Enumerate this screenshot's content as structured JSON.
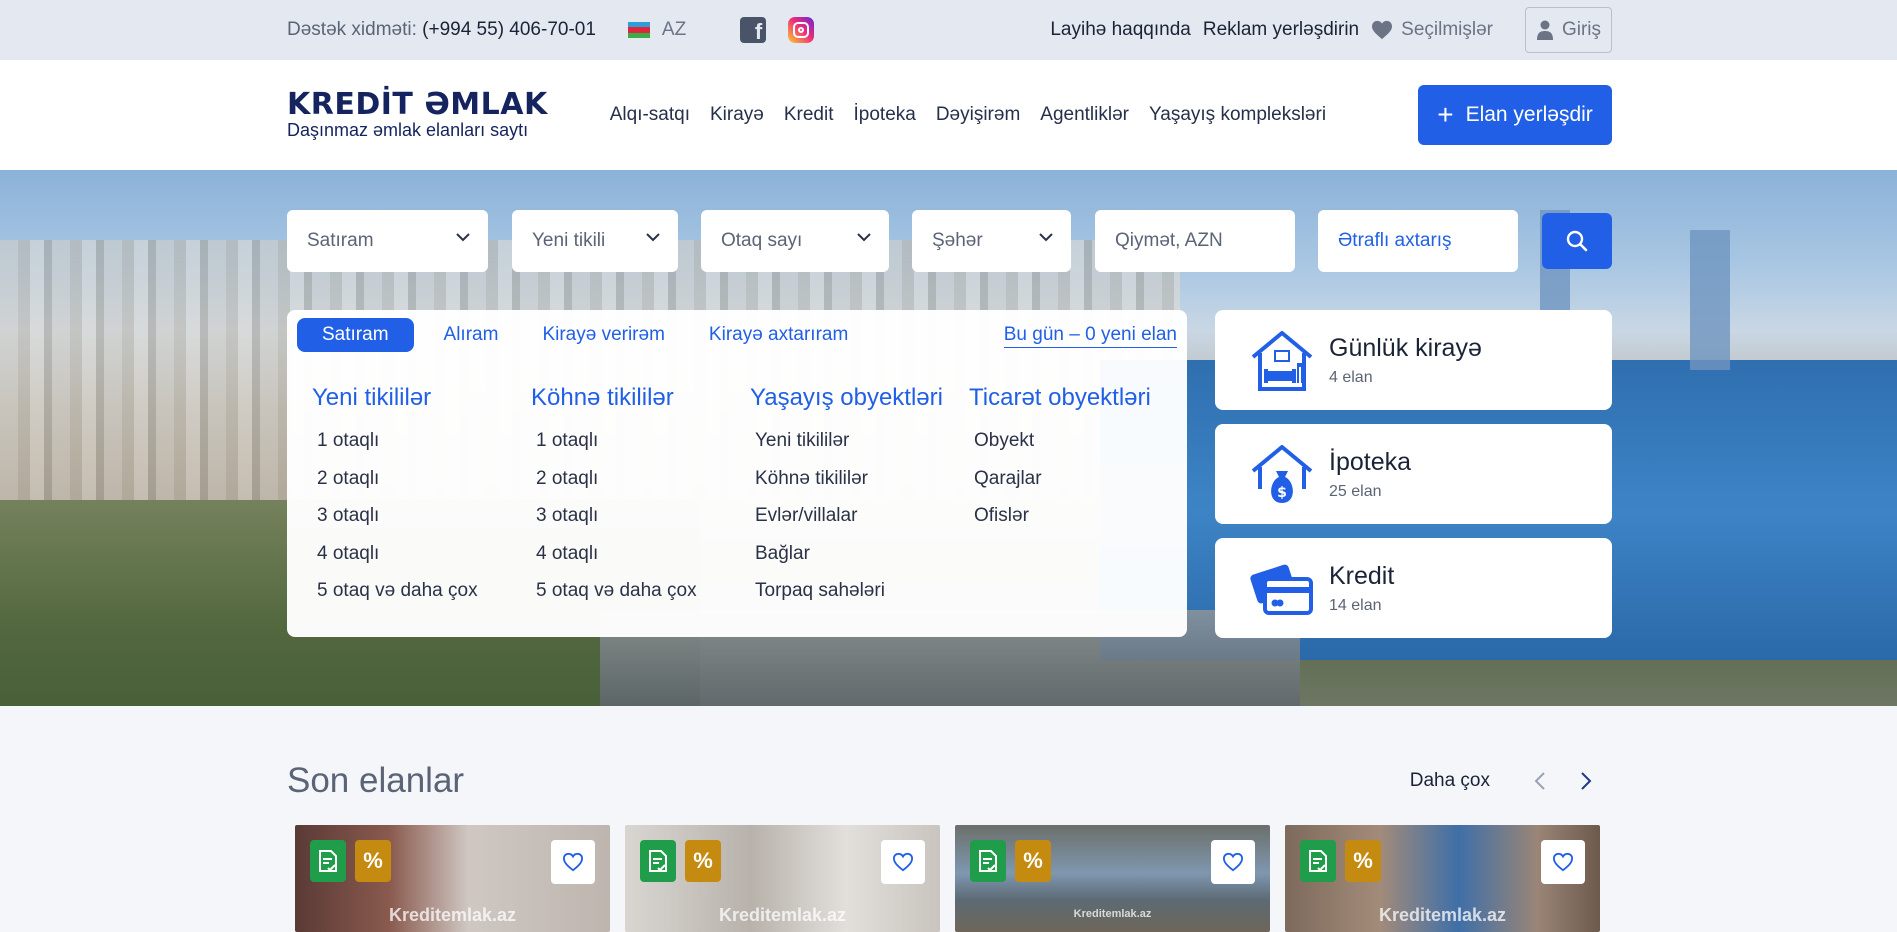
{
  "topbar": {
    "support_label": "Dəstək xidməti:",
    "support_phone": "(+994 55) 406-70-01",
    "language": "AZ",
    "links": [
      "Layihə haqqında",
      "Reklam yerləşdirin"
    ],
    "favorites": "Seçilmişlər",
    "login": "Giriş"
  },
  "header": {
    "logo_title": "KREDİT ƏMLAK",
    "logo_subtitle": "Daşınmaz əmlak elanları saytı",
    "nav": [
      "Alqı-satqı",
      "Kirayə",
      "Kredit",
      "İpoteka",
      "Dəyişirəm",
      "Agentliklər",
      "Yaşayış kompleksləri"
    ],
    "post_button": "Elan yerləşdir"
  },
  "search": {
    "deal_type": "Satıram",
    "building_type": "Yeni tikili",
    "rooms": "Otaq sayı",
    "city": "Şəhər",
    "price_placeholder": "Qiymət, AZN",
    "advanced": "Ətraflı axtarış"
  },
  "panel": {
    "tabs": [
      "Satıram",
      "Alıram",
      "Kirayə verirəm",
      "Kirayə axtarıram"
    ],
    "active_tab": "Satıram",
    "today": "Bu gün – 0 yeni elan",
    "columns": [
      {
        "title": "Yeni tikililər",
        "items": [
          "1 otaqlı",
          "2 otaqlı",
          "3 otaqlı",
          "4 otaqlı",
          "5 otaq və daha çox"
        ]
      },
      {
        "title": "Köhnə tikililər",
        "items": [
          "1 otaqlı",
          "2 otaqlı",
          "3 otaqlı",
          "4 otaqlı",
          "5 otaq və daha çox"
        ]
      },
      {
        "title": "Yaşayış obyektləri",
        "items": [
          "Yeni tikililər",
          "Köhnə tikililər",
          "Evlər/villalar",
          "Bağlar",
          "Torpaq sahələri"
        ]
      },
      {
        "title": "Ticarət obyektləri",
        "items": [
          "Obyekt",
          "Qarajlar",
          "Ofislər"
        ]
      }
    ]
  },
  "side_cards": [
    {
      "title": "Günlük kirayə",
      "count": "4 elan",
      "icon": "house-sofa-icon"
    },
    {
      "title": "İpoteka",
      "count": "25 elan",
      "icon": "house-moneybag-icon"
    },
    {
      "title": "Kredit",
      "count": "14 elan",
      "icon": "credit-card-icon"
    }
  ],
  "latest": {
    "title": "Son elanlar",
    "more": "Daha çox",
    "watermark": "Kreditemlak.az"
  },
  "colors": {
    "primary": "#2160e6",
    "logo": "#15235e",
    "badge_green": "#1f9d4b",
    "badge_orange": "#c58a10"
  }
}
